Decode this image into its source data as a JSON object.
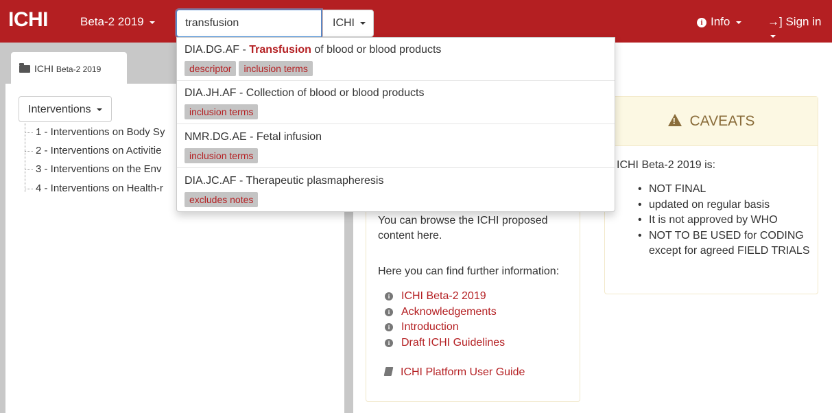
{
  "navbar": {
    "brand": "ICHI",
    "release": "Beta-2 2019",
    "search_value": "transfusion",
    "search_scope": "ICHI",
    "info": "Info",
    "sign_in": "Sign in"
  },
  "tab": {
    "label": "ICHI",
    "sub": "Beta-2 2019"
  },
  "hierarchy": {
    "button": "Interventions",
    "items": [
      "1 - Interventions on Body Sy",
      "2 - Interventions on Activitie",
      "3 - Interventions on the Env",
      "4 - Interventions on Health-r"
    ]
  },
  "suggestions": [
    {
      "code": "DIA.DG.AF",
      "pre": " - ",
      "match": "Transfusion",
      "rest": " of blood or blood products",
      "tags": [
        "descriptor",
        "inclusion terms"
      ]
    },
    {
      "code": "DIA.JH.AF",
      "pre": " - Collection of blood or blood products",
      "match": "",
      "rest": "",
      "tags": [
        "inclusion terms"
      ]
    },
    {
      "code": "NMR.DG.AE",
      "pre": " - Fetal infusion",
      "match": "",
      "rest": "",
      "tags": [
        "inclusion terms"
      ]
    },
    {
      "code": "DIA.JC.AF",
      "pre": " - Therapeutic plasmapheresis",
      "match": "",
      "rest": "",
      "tags": [
        "excludes notes"
      ]
    }
  ],
  "welcome": {
    "text": "You can browse the ICHI proposed content here.",
    "further": "Here you can find further information:",
    "links": [
      "ICHI Beta-2 2019",
      "Acknowledgements",
      "Introduction",
      "Draft ICHI Guidelines"
    ],
    "guide": "ICHI Platform User Guide"
  },
  "caveats": {
    "title": "CAVEATS",
    "intro": "ICHI Beta-2 2019 is:",
    "items": [
      "NOT FINAL",
      "updated on regular basis",
      "It is not approved by WHO",
      "NOT TO BE USED for CODING except for agreed FIELD TRIALS"
    ]
  },
  "colors": {
    "brand_red": "#b41f22",
    "warning_bg": "#fcf8e3",
    "warning_text": "#8a6d3b"
  }
}
